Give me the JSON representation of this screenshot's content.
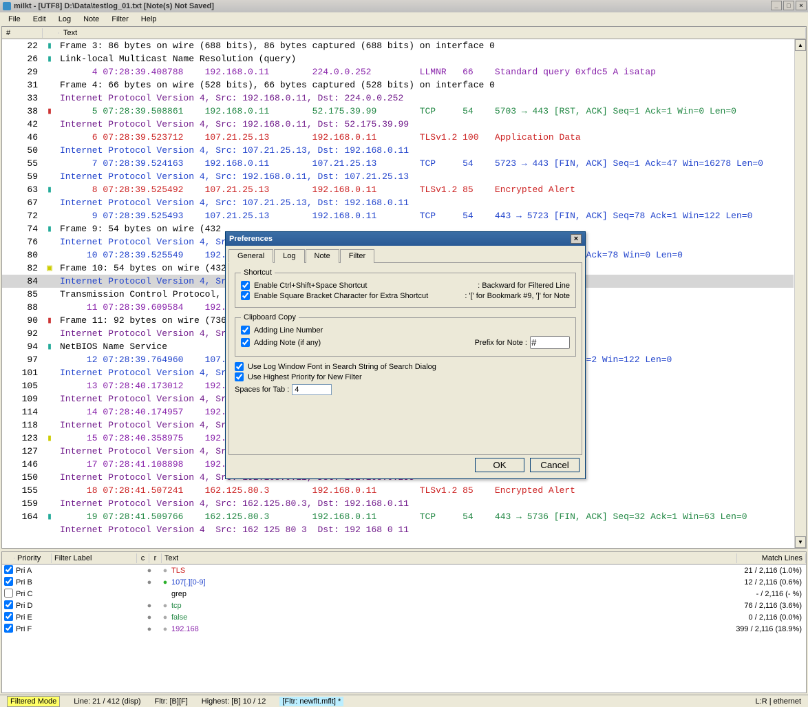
{
  "window": {
    "title": "milkt - [UTF8] D:\\Data\\testlog_01.txt [Note(s) Not Saved]",
    "min": "_",
    "max": "□",
    "close": "×"
  },
  "menu": [
    "File",
    "Edit",
    "Log",
    "Note",
    "Filter",
    "Help"
  ],
  "log_header": {
    "num": "#",
    "text": "Text"
  },
  "rows": [
    {
      "n": "22",
      "m": "▮",
      "mc": "#2a9",
      "t": "Frame 3: 86 bytes on wire (688 bits), 86 bytes captured (688 bits) on interface 0",
      "c": "c-black"
    },
    {
      "n": "26",
      "m": "▮",
      "mc": "#2a9",
      "t": "Link-local Multicast Name Resolution (query)",
      "c": "c-black"
    },
    {
      "n": "29",
      "m": "",
      "t": "      4 07:28:39.408788    192.168.0.11        224.0.0.252         LLMNR   66    Standard query 0xfdc5 A isatap",
      "c": "c-purple"
    },
    {
      "n": "31",
      "m": "",
      "t": "Frame 4: 66 bytes on wire (528 bits), 66 bytes captured (528 bits) on interface 0",
      "c": "c-black"
    },
    {
      "n": "33",
      "m": "",
      "t": "Internet Protocol Version 4, Src: 192.168.0.11, Dst: 224.0.0.252",
      "c": "c-dpur"
    },
    {
      "n": "38",
      "m": "▮",
      "mc": "#c33",
      "t": "      5 07:28:39.508861    192.168.0.11        52.175.39.99        TCP     54    5703 → 443 [RST, ACK] Seq=1 Ack=1 Win=0 Len=0",
      "c": "c-green"
    },
    {
      "n": "42",
      "m": "",
      "t": "Internet Protocol Version 4, Src: 192.168.0.11, Dst: 52.175.39.99",
      "c": "c-dpur"
    },
    {
      "n": "46",
      "m": "",
      "t": "      6 07:28:39.523712    107.21.25.13        192.168.0.11        TLSv1.2 100   Application Data",
      "c": "c-red"
    },
    {
      "n": "50",
      "m": "",
      "t": "Internet Protocol Version 4, Src: 107.21.25.13, Dst: 192.168.0.11",
      "c": "c-blue"
    },
    {
      "n": "55",
      "m": "",
      "t": "      7 07:28:39.524163    192.168.0.11        107.21.25.13        TCP     54    5723 → 443 [FIN, ACK] Seq=1 Ack=47 Win=16278 Len=0",
      "c": "c-blue"
    },
    {
      "n": "59",
      "m": "",
      "t": "Internet Protocol Version 4, Src: 192.168.0.11, Dst: 107.21.25.13",
      "c": "c-blue"
    },
    {
      "n": "63",
      "m": "▮",
      "mc": "#2a9",
      "t": "      8 07:28:39.525492    107.21.25.13        192.168.0.11        TLSv1.2 85    Encrypted Alert",
      "c": "c-red"
    },
    {
      "n": "67",
      "m": "",
      "t": "Internet Protocol Version 4, Src: 107.21.25.13, Dst: 192.168.0.11",
      "c": "c-blue"
    },
    {
      "n": "72",
      "m": "",
      "t": "      9 07:28:39.525493    107.21.25.13        192.168.0.11        TCP     54    443 → 5723 [FIN, ACK] Seq=78 Ack=1 Win=122 Len=0",
      "c": "c-blue"
    },
    {
      "n": "74",
      "m": "▮",
      "mc": "#2a9",
      "t": "Frame 9: 54 bytes on wire (432 ",
      "c": "c-black"
    },
    {
      "n": "76",
      "m": "",
      "t": "Internet Protocol Version 4, Sr",
      "c": "c-blue"
    },
    {
      "n": "80",
      "m": "",
      "t": "     10 07:28:39.525549    192.                                                             Seq=2 Ack=78 Win=0 Len=0",
      "c": "c-blue"
    },
    {
      "n": "82",
      "m": "▣",
      "mc": "#cc0",
      "t": "Frame 10: 54 bytes on wire (432",
      "c": "c-black"
    },
    {
      "n": "84",
      "m": "",
      "t": "Internet Protocol Version 4, Sr",
      "c": "c-blue",
      "sel": true
    },
    {
      "n": "85",
      "m": "",
      "t": "Transmission Control Protocol, ",
      "c": "c-black"
    },
    {
      "n": "88",
      "m": "",
      "t": "     11 07:28:39.609584    192.                                                           k00>",
      "c": "c-purple"
    },
    {
      "n": "90",
      "m": "▮",
      "mc": "#c33",
      "t": "Frame 11: 92 bytes on wire (736",
      "c": "c-black"
    },
    {
      "n": "92",
      "m": "",
      "t": "Internet Protocol Version 4, Sr",
      "c": "c-dpur"
    },
    {
      "n": "94",
      "m": "▮",
      "mc": "#2a9",
      "t": "NetBIOS Name Service",
      "c": "c-black"
    },
    {
      "n": "97",
      "m": "",
      "t": "     12 07:28:39.764960    107.                                                           k=79 Ack=2 Win=122 Len=0",
      "c": "c-blue"
    },
    {
      "n": "101",
      "m": "",
      "t": "Internet Protocol Version 4, Sr",
      "c": "c-blue"
    },
    {
      "n": "105",
      "m": "",
      "t": "     13 07:28:40.173012    192.                                                           k00>",
      "c": "c-purple"
    },
    {
      "n": "109",
      "m": "",
      "t": "Internet Protocol Version 4, Sr",
      "c": "c-dpur"
    },
    {
      "n": "114",
      "m": "",
      "t": "     14 07:28:40.174957    192.                                                           k00>",
      "c": "c-purple"
    },
    {
      "n": "118",
      "m": "",
      "t": "Internet Protocol Version 4, Sr",
      "c": "c-dpur"
    },
    {
      "n": "123",
      "m": "▮",
      "mc": "#cc0",
      "t": "     15 07:28:40.358975    192.                                                           k00>",
      "c": "c-purple"
    },
    {
      "n": "127",
      "m": "",
      "t": "Internet Protocol Version 4, Sr",
      "c": "c-dpur"
    },
    {
      "n": "146",
      "m": "",
      "t": "     17 07:28:41.108898    192.                                                           k00>",
      "c": "c-purple"
    },
    {
      "n": "150",
      "m": "",
      "t": "Internet Protocol Version 4, Src: 192.168.0.11, Dst: 192.168.0.255",
      "c": "c-dpur"
    },
    {
      "n": "155",
      "m": "",
      "t": "     18 07:28:41.507241    162.125.80.3        192.168.0.11        TLSv1.2 85    Encrypted Alert",
      "c": "c-red"
    },
    {
      "n": "159",
      "m": "",
      "t": "Internet Protocol Version 4, Src: 162.125.80.3, Dst: 192.168.0.11",
      "c": "c-dpur"
    },
    {
      "n": "164",
      "m": "▮",
      "mc": "#2a9",
      "t": "     19 07:28:41.509766    162.125.80.3        192.168.0.11        TCP     54    443 → 5736 [FIN, ACK] Seq=32 Ack=1 Win=63 Len=0",
      "c": "c-green"
    },
    {
      "n": "",
      "m": "",
      "t": "Internet Protocol Version 4  Src: 162 125 80 3  Dst: 192 168 0 11",
      "c": "c-dpur"
    }
  ],
  "filter_header": {
    "check": "",
    "pri": "Priority",
    "label": "Filter Label",
    "c": "c",
    "r": "r",
    "text": "Text",
    "match": "Match Lines"
  },
  "filters": [
    {
      "chk": true,
      "pri": "Pri A",
      "c": "●",
      "cc": "gray",
      "r": "●",
      "rc": "gray",
      "t": "TLS",
      "tc": "c-red",
      "m": "21 / 2,116 (1.0%)"
    },
    {
      "chk": true,
      "pri": "Pri B",
      "c": "●",
      "cc": "gray",
      "r": "●",
      "rc": "green",
      "t": "107[.][0-9]",
      "tc": "c-blue",
      "m": "12 / 2,116 (0.6%)"
    },
    {
      "chk": false,
      "pri": "Pri C",
      "c": "",
      "r": "",
      "t": "grep",
      "tc": "c-black",
      "m": "- / 2,116 (- %)"
    },
    {
      "chk": true,
      "pri": "Pri D",
      "c": "●",
      "cc": "gray",
      "r": "●",
      "rc": "gray",
      "t": "tcp",
      "tc": "c-green",
      "m": "76 / 2,116 (3.6%)"
    },
    {
      "chk": true,
      "pri": "Pri E",
      "c": "●",
      "cc": "green",
      "r": "●",
      "rc": "gray",
      "t": "false",
      "tc": "c-green",
      "m": "0 / 2,116 (0.0%)"
    },
    {
      "chk": true,
      "pri": "Pri F",
      "c": "●",
      "cc": "gray",
      "r": "●",
      "rc": "gray",
      "t": "192.168",
      "tc": "c-purple",
      "m": "399 / 2,116 (18.9%)"
    }
  ],
  "status": {
    "mode": "Filtered Mode",
    "line": "Line: 21 / 412 (disp)",
    "fltr": "Fltr: [B][F]",
    "highest": "Highest: [B] 10 / 12",
    "fltfile": "[Fltr: newflt.mflt] *",
    "lr": "L:R | ethernet"
  },
  "dialog": {
    "title": "Preferences",
    "tabs": [
      "General",
      "Log",
      "Note",
      "Filter"
    ],
    "shortcut": {
      "legend": "Shortcut",
      "c1": "Enable Ctrl+Shift+Space Shortcut",
      "h1": ": Backward for Filtered Line",
      "c2": "Enable Square Bracket Character for Extra Shortcut",
      "h2": ": '[' for Bookmark #9, ']' for Note"
    },
    "clipboard": {
      "legend": "Clipboard Copy",
      "c1": "Adding Line Number",
      "c2": "Adding Note (if any)",
      "prefix_label": "Prefix for Note :",
      "prefix_val": "#"
    },
    "opt1": "Use Log Window Font in Search String of Search Dialog",
    "opt2": "Use Highest Priority for New Filter",
    "spaces_label": "Spaces for Tab :",
    "spaces_val": "4",
    "ok": "OK",
    "cancel": "Cancel"
  }
}
